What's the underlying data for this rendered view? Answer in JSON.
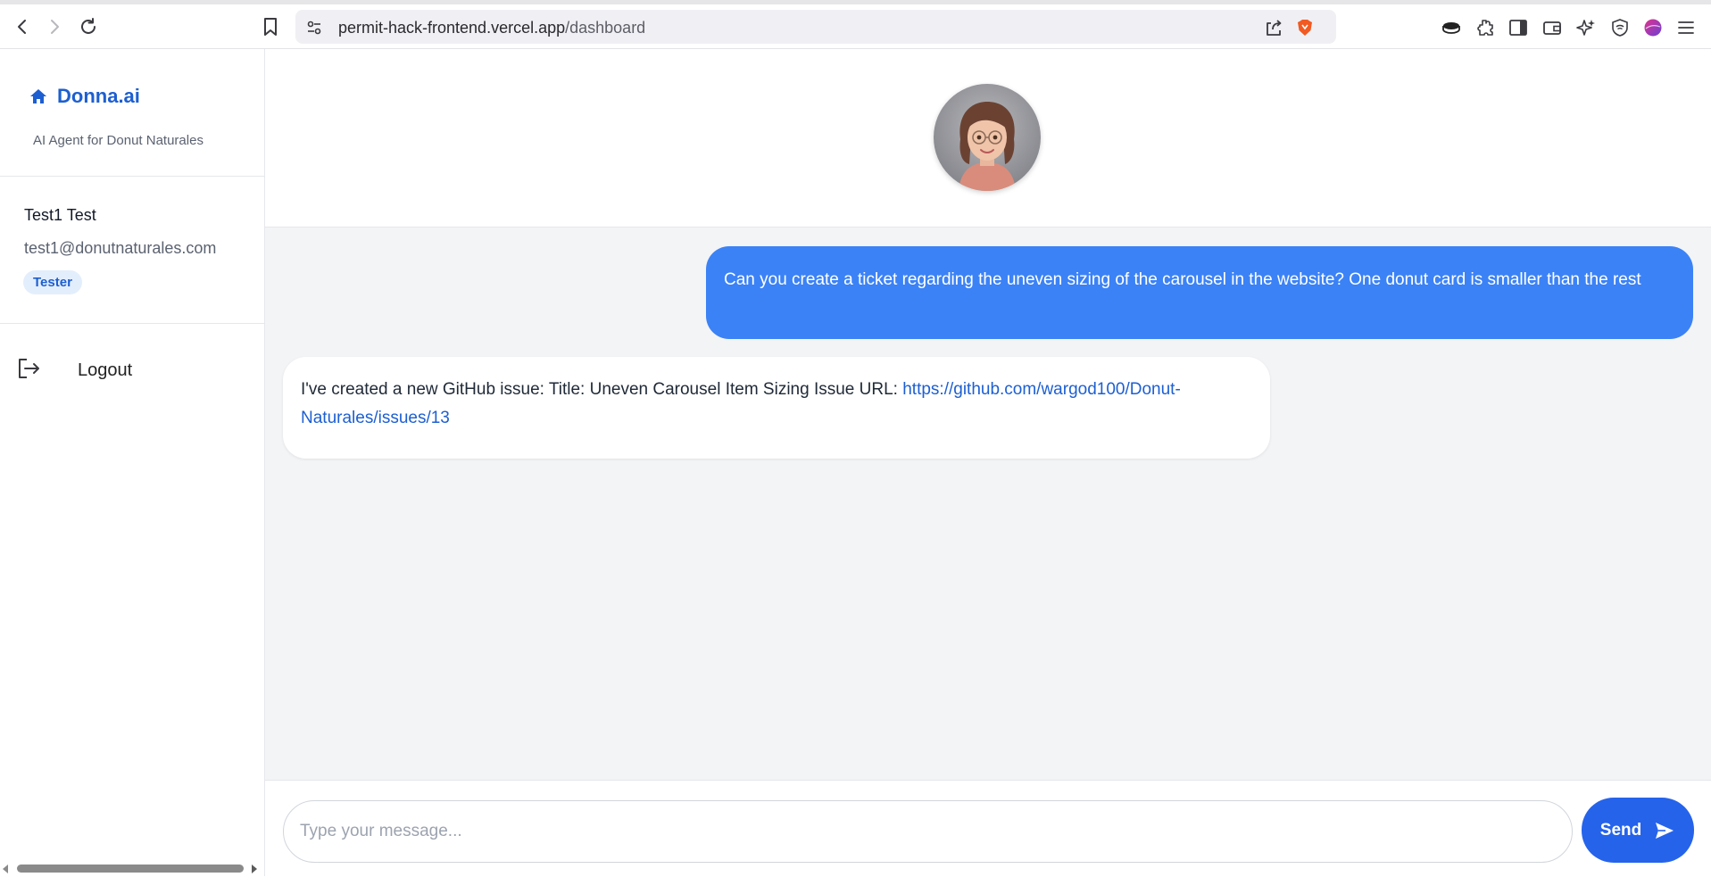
{
  "browser": {
    "url_host": "permit-hack-frontend.vercel.app",
    "url_path": "/dashboard"
  },
  "sidebar": {
    "brand_name": "Donna.ai",
    "brand_subtitle": "AI Agent for Donut Naturales",
    "user": {
      "name": "Test1 Test",
      "email": "test1@donutnaturales.com",
      "role": "Tester"
    },
    "logout_label": "Logout"
  },
  "chat": {
    "messages": [
      {
        "sender": "user",
        "text": "Can you create a ticket regarding the uneven sizing of the carousel in the website? One donut card is smaller than the rest"
      },
      {
        "sender": "assistant",
        "text": "I've created a new GitHub issue: Title: Uneven Carousel Item Sizing Issue URL: ",
        "link": "https://github.com/wargod100/Donut-Naturales/issues/13"
      }
    ],
    "input_placeholder": "Type your message...",
    "send_label": "Send"
  },
  "colors": {
    "accent": "#2563eb",
    "user_bubble": "#3b82f6",
    "brand": "#1d5fd1"
  }
}
